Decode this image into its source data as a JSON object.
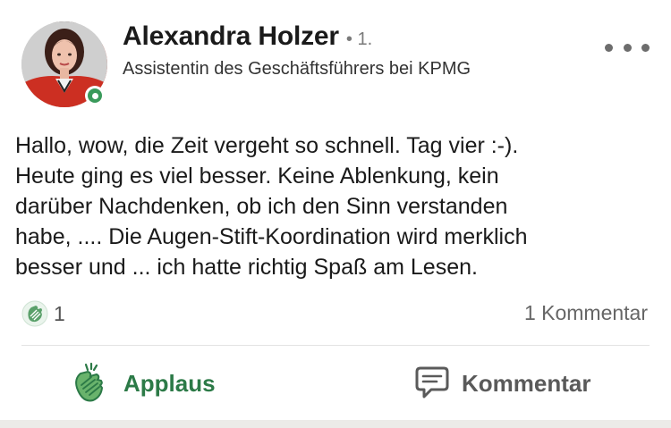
{
  "author": {
    "name": "Alexandra Holzer",
    "degree": "• 1.",
    "headline": "Assistentin des Geschäftsführers bei KPMG",
    "online_status_color": "#3a9a5b"
  },
  "post": {
    "text_lines": [
      "Hallo, wow, die Zeit vergeht so schnell. Tag vier :-).",
      "Heute ging es viel besser. Keine Ablenkung, kein",
      "darüber Nachdenken, ob ich den Sinn verstanden",
      "habe, .... Die Augen-Stift-Koordination wird merklich",
      "besser und ... ich hatte richtig Spaß am Lesen."
    ]
  },
  "social": {
    "reaction_icon": "clapping-hands-icon",
    "reaction_count": "1",
    "comment_count": "1 Kommentar"
  },
  "actions": {
    "applaus_label": "Applaus",
    "applaus_icon": "clapping-hands-icon",
    "applaus_color": "#2c7a47",
    "comment_label": "Kommentar",
    "comment_icon": "speech-bubble-icon",
    "comment_color": "#5a5a5a"
  },
  "menu": {
    "more_icon": "more-options-icon"
  }
}
